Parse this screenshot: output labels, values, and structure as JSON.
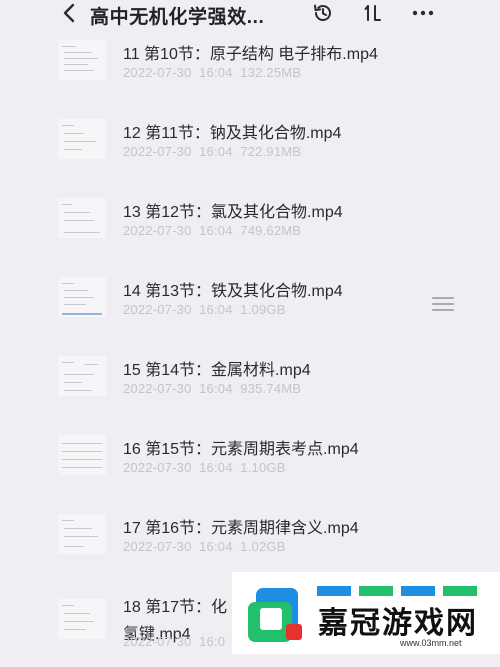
{
  "header": {
    "title": "高中无机化学强效..."
  },
  "icons": {
    "back": "chevron-left-icon",
    "history": "history-icon",
    "sort": "sort-icon",
    "more": "more-horizontal-icon",
    "drag": "drag-handle-icon"
  },
  "files": [
    {
      "name": "11 第10节：原子结构 电子排布.mp4",
      "date": "2022-07-30",
      "time": "16:04",
      "size": "132.25MB"
    },
    {
      "name": "12 第11节：钠及其化合物.mp4",
      "date": "2022-07-30",
      "time": "16:04",
      "size": "722.91MB"
    },
    {
      "name": "13 第12节：氯及其化合物.mp4",
      "date": "2022-07-30",
      "time": "16:04",
      "size": "749.62MB"
    },
    {
      "name": "14 第13节：铁及其化合物.mp4",
      "date": "2022-07-30",
      "time": "16:04",
      "size": "1.09GB"
    },
    {
      "name": "15 第14节：金属材料.mp4",
      "date": "2022-07-30",
      "time": "16:04",
      "size": "935.74MB"
    },
    {
      "name": "16 第15节：元素周期表考点.mp4",
      "date": "2022-07-30",
      "time": "16:04",
      "size": "1.10GB"
    },
    {
      "name": "17 第16节：元素周期律含义.mp4",
      "date": "2022-07-30",
      "time": "16:04",
      "size": "1.02GB"
    },
    {
      "name": "18 第17节：化",
      "name_line2": "氢键.mp4",
      "date": "2022-07-30",
      "time": "16:0"
    }
  ],
  "watermark": {
    "text": "嘉冠游戏网",
    "url": "www.03mm.net",
    "colors": {
      "blue": "#1e8fe0",
      "green": "#23c06b",
      "red": "#e8302f"
    }
  }
}
